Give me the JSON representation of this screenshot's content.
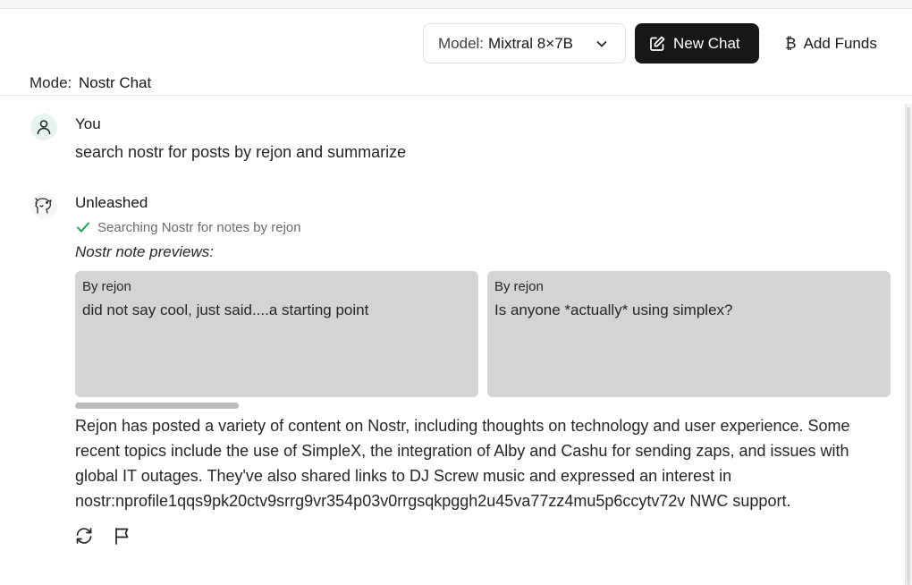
{
  "header": {
    "model_label": "Model:",
    "model_value": "Mixtral 8×7B",
    "new_chat_label": "New Chat",
    "add_funds_label": "Add Funds",
    "add_funds_symbol": "₿",
    "mode_label": "Mode:",
    "mode_value": "Nostr Chat"
  },
  "chat": {
    "user": {
      "name": "You",
      "message": "search nostr for posts by rejon and summarize"
    },
    "assistant": {
      "name": "Unleashed",
      "status": "Searching Nostr for notes by rejon",
      "previews_title": "Nostr note previews:",
      "notes": [
        {
          "by_label": "By",
          "author": "rejon",
          "text": "did not say cool, just said....a starting point"
        },
        {
          "by_label": "By",
          "author": "rejon",
          "text": "Is anyone *actually* using simplex?"
        }
      ],
      "summary": "Rejon has posted a variety of content on Nostr, including thoughts on technology and user experience. Some recent topics include the use of SimpleX, the integration of Alby and Cashu for sending zaps, and issues with global IT outages. They've also shared links to DJ Screw music and expressed an interest in nostr:nprofile1qqs9pk20ctv9srrg9vr354p03v0rrgsqkpggh2u45va77zz4mu5p6ccytv72v NWC support."
    }
  },
  "icons": {
    "chevron": "chevron-down-icon",
    "new_chat": "edit-square-icon",
    "add_funds": "bitcoin-icon",
    "user_avatar": "user-icon",
    "bot_avatar": "bear-logo-icon",
    "status": "check-icon",
    "regenerate": "refresh-icon",
    "report": "flag-icon"
  },
  "colors": {
    "primary_button": "#171717",
    "note_background": "#d4d4d4",
    "status_check": "#22a35a",
    "user_avatar_bg": "#e8f5ee"
  }
}
